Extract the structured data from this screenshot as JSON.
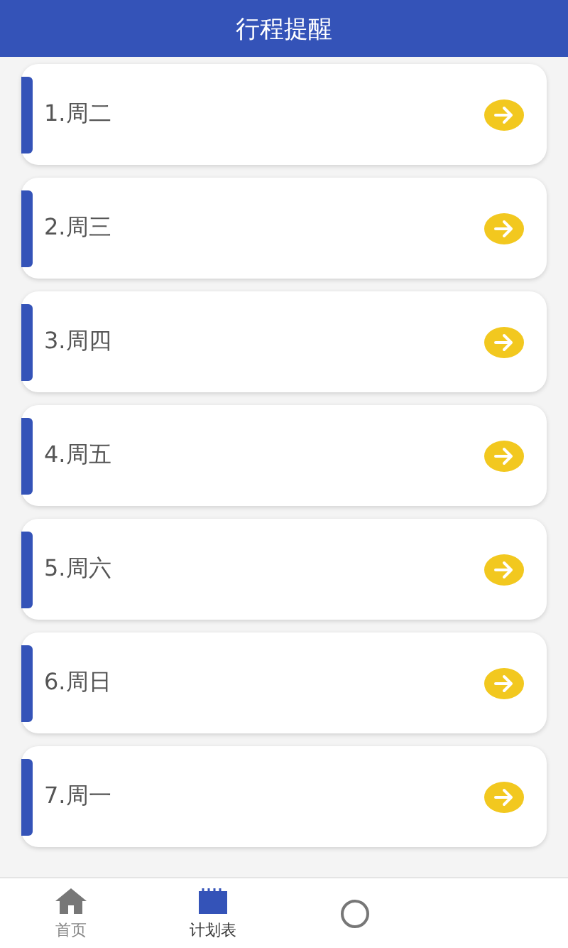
{
  "header": {
    "title": "行程提醒"
  },
  "items": [
    {
      "label": "1.周二"
    },
    {
      "label": "2.周三"
    },
    {
      "label": "3.周四"
    },
    {
      "label": "4.周五"
    },
    {
      "label": "5.周六"
    },
    {
      "label": "6.周日"
    },
    {
      "label": "7.周一"
    }
  ],
  "tabs": [
    {
      "label": "首页",
      "kind": "home",
      "selected": false
    },
    {
      "label": "计划表",
      "kind": "calendar",
      "selected": true
    },
    {
      "kind": "circle",
      "selected": false
    }
  ]
}
